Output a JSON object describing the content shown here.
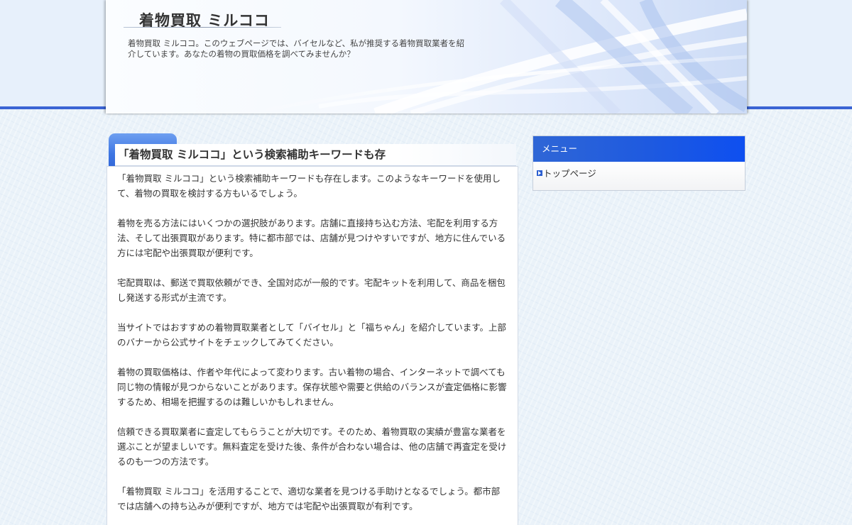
{
  "site": {
    "title": "着物買取 ミルココ",
    "description": "着物買取 ミルココ。このウェブページでは、バイセルなど、私が推奨する着物買取業者を紹介しています。あなたの着物の買取価格を調べてみませんか？"
  },
  "post": {
    "title": "「着物買取 ミルココ」という検索補助キーワードも存",
    "paragraphs": [
      "「着物買取 ミルココ」という検索補助キーワードも存在します。このようなキーワードを使用して、着物の買取を検討する方もいるでしょう。",
      "着物を売る方法にはいくつかの選択肢があります。店舗に直接持ち込む方法、宅配を利用する方法、そして出張買取があります。特に都市部では、店舗が見つけやすいですが、地方に住んでいる方には宅配や出張買取が便利です。",
      "宅配買取は、郵送で買取依頼ができ、全国対応が一般的です。宅配キットを利用して、商品を梱包し発送する形式が主流です。",
      "当サイトではおすすめの着物買取業者として「バイセル」と「福ちゃん」を紹介しています。上部のバナーから公式サイトをチェックしてみてください。",
      "着物の買取価格は、作者や年代によって変わります。古い着物の場合、インターネットで調べても同じ物の情報が見つからないことがあります。保存状態や需要と供給のバランスが査定価格に影響するため、相場を把握するのは難しいかもしれません。",
      "信頼できる買取業者に査定してもらうことが大切です。そのため、着物買取の実績が豊富な業者を選ぶことが望ましいです。無料査定を受けた後、条件が合わない場合は、他の店舗で再査定を受けるのも一つの方法です。",
      "「着物買取 ミルココ」を活用することで、適切な業者を見つける手助けとなるでしょう。都市部では店舗への持ち込みが便利ですが、地方では宅配や出張買取が有利です。"
    ]
  },
  "sidebar": {
    "menu_title": "メニュー",
    "items": [
      {
        "label": "トップページ",
        "icon": "arrow-right-icon"
      }
    ]
  },
  "colors": {
    "accent": "#3a64d4",
    "menu_header": "#1e5ae0",
    "background": "#eaf2f9"
  }
}
